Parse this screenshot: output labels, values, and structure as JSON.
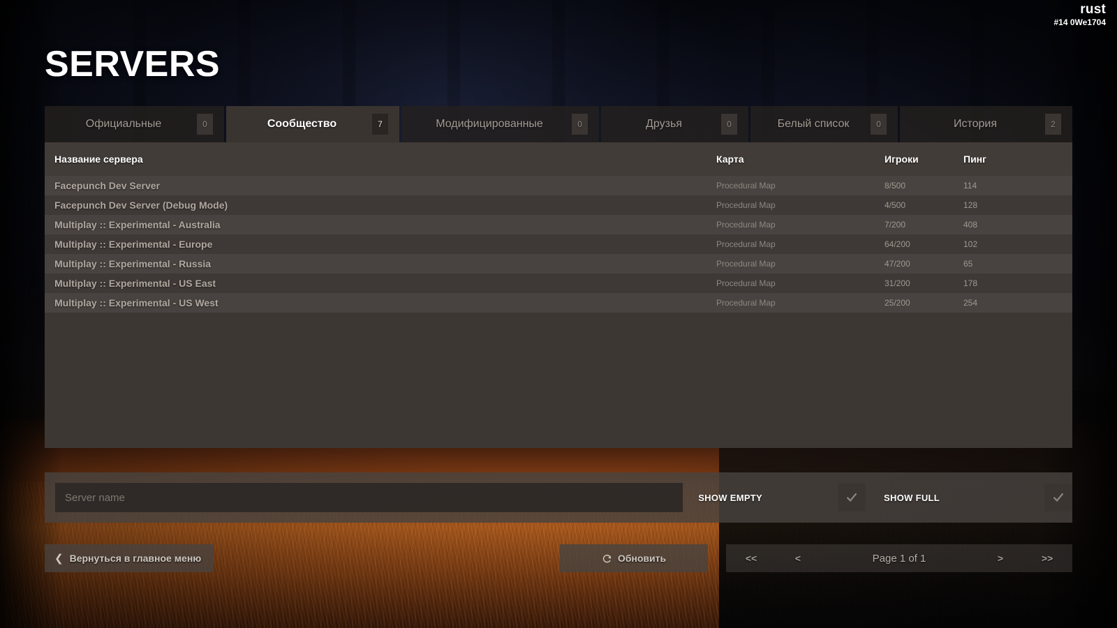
{
  "brand": {
    "name": "rust",
    "build": "#14 0We1704"
  },
  "page": {
    "title": "SERVERS"
  },
  "tabs": [
    {
      "label": "Официальные",
      "badge": "0",
      "active": false
    },
    {
      "label": "Сообщество",
      "badge": "7",
      "active": true
    },
    {
      "label": "Модифицированные",
      "badge": "0",
      "active": false
    },
    {
      "label": "Друзья",
      "badge": "0",
      "active": false
    },
    {
      "label": "Белый список",
      "badge": "0",
      "active": false
    },
    {
      "label": "История",
      "badge": "2",
      "active": false
    }
  ],
  "table": {
    "headers": {
      "name": "Название сервера",
      "map": "Карта",
      "players": "Игроки",
      "ping": "Пинг"
    },
    "rows": [
      {
        "name": "Facepunch Dev Server",
        "map": "Procedural Map",
        "players": "8/500",
        "ping": "114"
      },
      {
        "name": "Facepunch Dev Server (Debug Mode)",
        "map": "Procedural Map",
        "players": "4/500",
        "ping": "128"
      },
      {
        "name": "Multiplay :: Experimental - Australia",
        "map": "Procedural Map",
        "players": "7/200",
        "ping": "408"
      },
      {
        "name": "Multiplay :: Experimental - Europe",
        "map": "Procedural Map",
        "players": "64/200",
        "ping": "102"
      },
      {
        "name": "Multiplay :: Experimental - Russia",
        "map": "Procedural Map",
        "players": "47/200",
        "ping": "65"
      },
      {
        "name": "Multiplay :: Experimental - US East",
        "map": "Procedural Map",
        "players": "31/200",
        "ping": "178"
      },
      {
        "name": "Multiplay :: Experimental - US West",
        "map": "Procedural Map",
        "players": "25/200",
        "ping": "254"
      }
    ]
  },
  "filters": {
    "search_value": "",
    "search_placeholder": "Server name",
    "show_empty_label": "SHOW EMPTY",
    "show_empty_checked": true,
    "show_full_label": "SHOW FULL",
    "show_full_checked": true
  },
  "footer": {
    "back_label": "Вернуться в главное меню",
    "back_icon": "chevron-left-icon",
    "refresh_label": "Обновить",
    "refresh_icon": "refresh-icon",
    "pager": {
      "first": "<<",
      "prev": "<",
      "info": "Page 1 of 1",
      "next": ">",
      "last": ">>"
    }
  },
  "colors": {
    "panel_bg": "#3d3734",
    "panel_header_bg": "#423c38",
    "row_odd": "#484340",
    "row_even": "#3e3937",
    "tab_active_bg": "#3c3632",
    "text_primary": "#ffffff",
    "text_muted": "#a39c95",
    "fire_glow": "#e2782 4"
  }
}
